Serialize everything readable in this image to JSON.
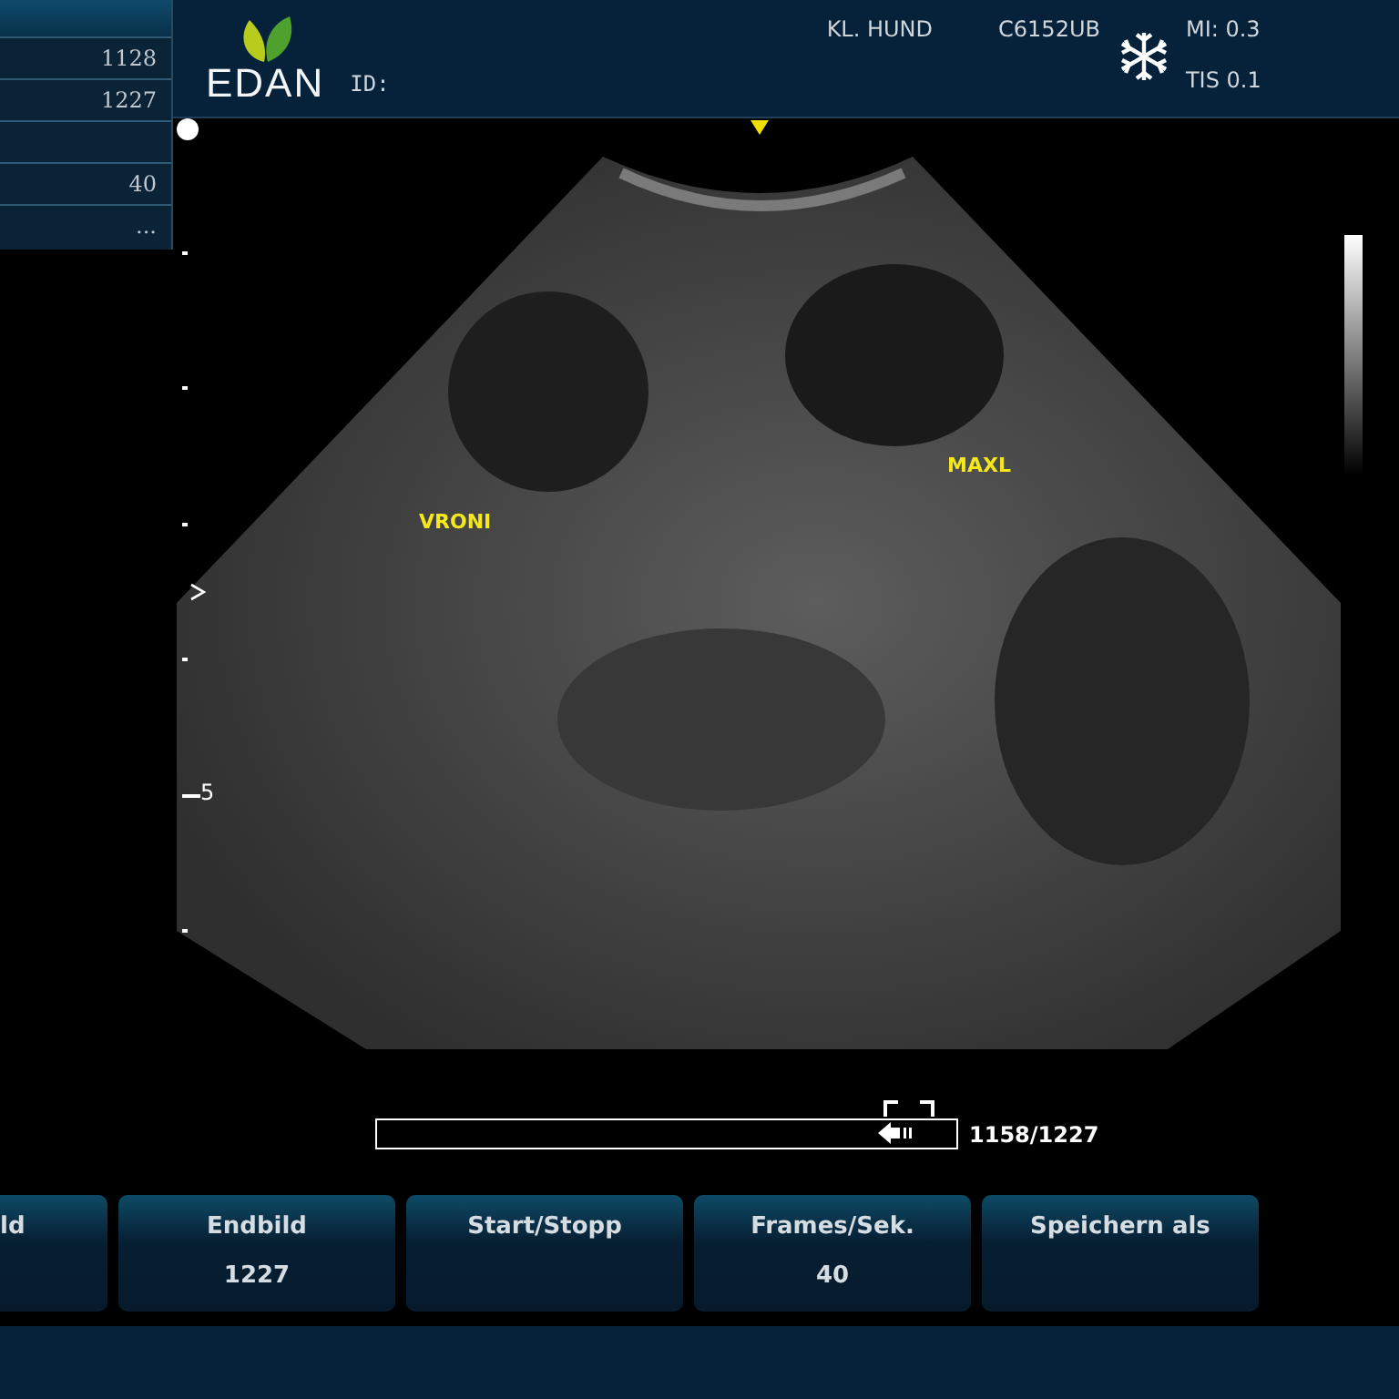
{
  "side_panel": {
    "rows": [
      {
        "value": "1128"
      },
      {
        "value": "1227"
      },
      {},
      {
        "value": "40"
      },
      {
        "value": "..."
      }
    ]
  },
  "top_bar": {
    "logo": "EDAN",
    "id_label": "ID:",
    "preset": "KL. HUND",
    "probe": "C6152UB",
    "frozen": true,
    "mi": "MI: 0.3",
    "tis": "TIS 0.1"
  },
  "image": {
    "annotations": [
      {
        "text": "VRONI"
      },
      {
        "text": "MAXL"
      }
    ],
    "depth_label": "5"
  },
  "cine": {
    "level": 0.96,
    "frame": "1158/1227"
  },
  "buttons": [
    {
      "label": "ld"
    },
    {
      "label": "Endbild",
      "value": "1227"
    },
    {
      "label": "Start/Stopp"
    },
    {
      "label": "Frames/Sek.",
      "value": "40"
    },
    {
      "label": "Speichern als"
    }
  ]
}
